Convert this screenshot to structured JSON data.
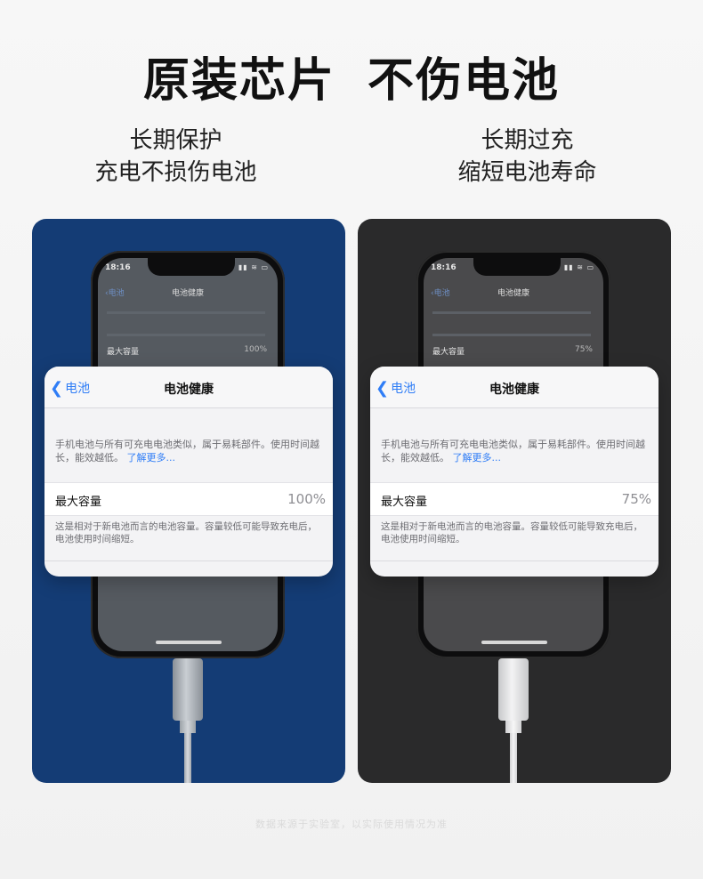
{
  "headline": [
    "原装芯片",
    "不伤电池"
  ],
  "left": {
    "subtitle": [
      "长期保护",
      "充电不损伤电池"
    ],
    "phone": {
      "status_time": "18:16",
      "status_icons": "▮▮ ≋ ▭",
      "back": "电池",
      "title": "电池健康",
      "mini_label": "最大容量",
      "mini_value": "100%"
    },
    "card": {
      "back": "电池",
      "title": "电池健康",
      "desc": "手机电池与所有可充电电池类似，属于易耗部件。使用时间越长，能效越低。",
      "link": "了解更多...",
      "capacity_label": "最大容量",
      "capacity_value": "100%",
      "note": "这是相对于新电池而言的电池容量。容量较低可能导致充电后，电池使用时间缩短。"
    },
    "background": "#143c75"
  },
  "right": {
    "subtitle": [
      "长期过充",
      "缩短电池寿命"
    ],
    "phone": {
      "status_time": "18:16",
      "status_icons": "▮▮ ≋ ▭",
      "back": "电池",
      "title": "电池健康",
      "mini_label": "最大容量",
      "mini_value": "75%"
    },
    "card": {
      "back": "电池",
      "title": "电池健康",
      "desc": "手机电池与所有可充电电池类似，属于易耗部件。使用时间越长，能效越低。",
      "link": "了解更多...",
      "capacity_label": "最大容量",
      "capacity_value": "75%",
      "note": "这是相对于新电池而言的电池容量。容量较低可能导致充电后，电池使用时间缩短。"
    },
    "background": "#2a2a2b"
  },
  "footnote": "数据来源于实验室，以实际使用情况为准",
  "colors": {
    "link_blue": "#2f7df6",
    "value_gray": "#8e8e93"
  }
}
